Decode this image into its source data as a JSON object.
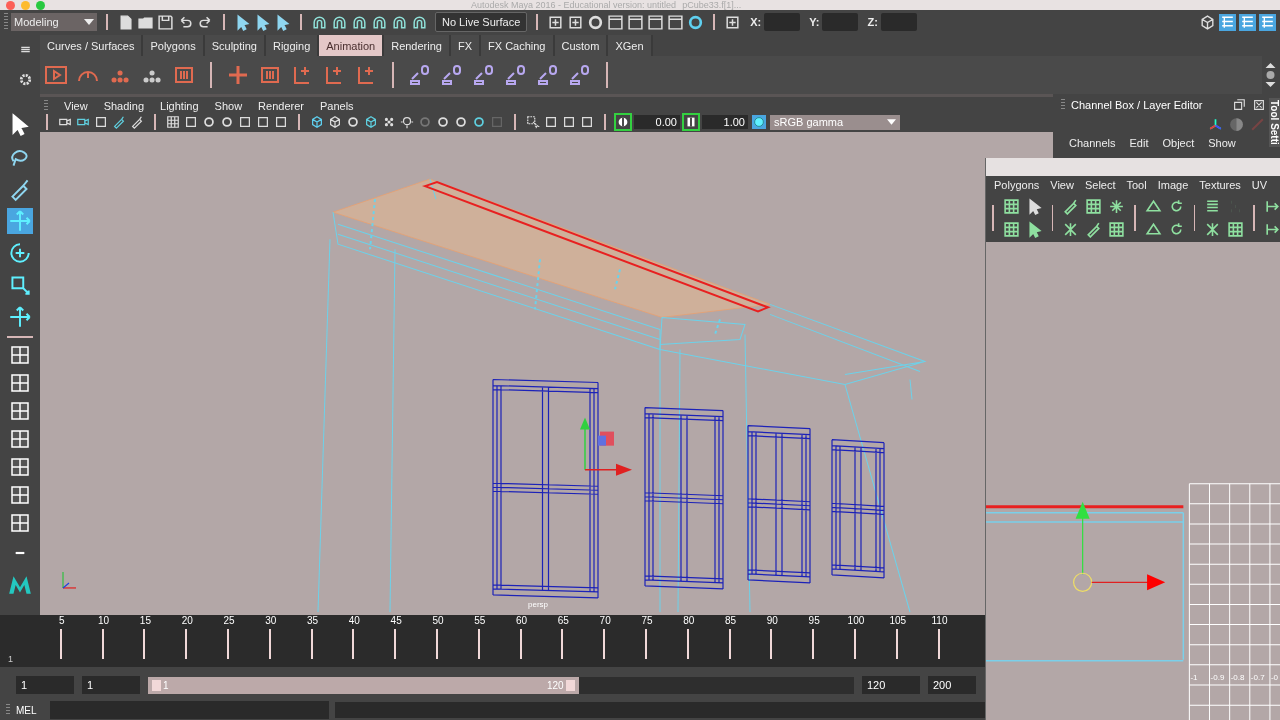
{
  "title_bar": {
    "title": "Autodesk Maya 2016 - Educational version: untitled",
    "object": "pCube33.f[1]..."
  },
  "status_line": {
    "mode": "Modeling",
    "live_surface": "No Live Surface",
    "coords": [
      "X:",
      "Y:",
      "Z:"
    ]
  },
  "shelf_tabs": [
    {
      "label": "Curves / Surfaces",
      "selected": false
    },
    {
      "label": "Polygons",
      "selected": false
    },
    {
      "label": "Sculpting",
      "selected": false
    },
    {
      "label": "Rigging",
      "selected": false
    },
    {
      "label": "Animation",
      "selected": true
    },
    {
      "label": "Rendering",
      "selected": false
    },
    {
      "label": "FX",
      "selected": false
    },
    {
      "label": "FX Caching",
      "selected": false
    },
    {
      "label": "Custom",
      "selected": false
    },
    {
      "label": "XGen",
      "selected": false
    }
  ],
  "toolbox": [
    {
      "selected": false
    },
    {
      "selected": false
    },
    {
      "selected": false
    },
    {
      "selected": true
    },
    {
      "selected": false
    },
    {
      "selected": false
    },
    {
      "selected": false
    }
  ],
  "viewport": {
    "menus": [
      "View",
      "Shading",
      "Lighting",
      "Show",
      "Renderer",
      "Panels"
    ],
    "exposure": "0.00",
    "gamma": "1.00",
    "color_space": "sRGB gamma",
    "camera": "persp"
  },
  "channel_box": {
    "title": "Channel Box / Layer Editor",
    "menus": [
      "Channels",
      "Edit",
      "Object",
      "Show"
    ],
    "side_tab": "Tool Setti"
  },
  "uv_editor": {
    "menus": [
      "Polygons",
      "View",
      "Select",
      "Tool",
      "Image",
      "Textures",
      "UV"
    ],
    "axis_labels": [
      "-1",
      "-0.9",
      "-0.8",
      "-0.7",
      "-0"
    ]
  },
  "timeline": {
    "ticks": [
      "5",
      "10",
      "15",
      "20",
      "25",
      "30",
      "35",
      "40",
      "45",
      "50",
      "55",
      "60",
      "65",
      "70",
      "75",
      "80",
      "85",
      "90",
      "95",
      "100",
      "105",
      "110"
    ],
    "current": "1"
  },
  "range": {
    "start": "1",
    "playback_start": "1",
    "slider_start": "1",
    "slider_end": "120",
    "level": 0.61,
    "playback_end": "120",
    "end": "200"
  },
  "command_line": {
    "language": "MEL"
  }
}
